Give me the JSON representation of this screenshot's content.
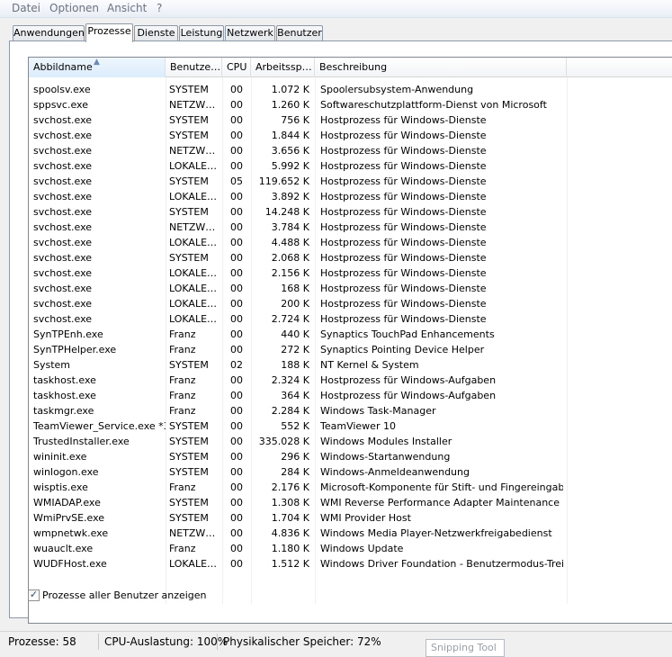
{
  "menu": [
    "Datei",
    "Optionen",
    "Ansicht",
    "?"
  ],
  "tabs": [
    "Anwendungen",
    "Prozesse",
    "Dienste",
    "Leistung",
    "Netzwerk",
    "Benutzer"
  ],
  "active_tab": "Prozesse",
  "columns": {
    "name": "Abbildname",
    "user": "Benutze…",
    "cpu": "CPU",
    "mem": "Arbeitssp…",
    "desc": "Beschreibung"
  },
  "rows": [
    {
      "name": "spoolsv.exe",
      "user": "SYSTEM",
      "cpu": "00",
      "mem": "1.072 K",
      "desc": "Spoolersubsystem-Anwendung"
    },
    {
      "name": "sppsvc.exe",
      "user": "NETZW…",
      "cpu": "00",
      "mem": "1.260 K",
      "desc": "Softwareschutzplattform-Dienst von Microsoft"
    },
    {
      "name": "svchost.exe",
      "user": "SYSTEM",
      "cpu": "00",
      "mem": "756 K",
      "desc": "Hostprozess für Windows-Dienste"
    },
    {
      "name": "svchost.exe",
      "user": "SYSTEM",
      "cpu": "00",
      "mem": "1.844 K",
      "desc": "Hostprozess für Windows-Dienste"
    },
    {
      "name": "svchost.exe",
      "user": "NETZW…",
      "cpu": "00",
      "mem": "3.656 K",
      "desc": "Hostprozess für Windows-Dienste"
    },
    {
      "name": "svchost.exe",
      "user": "LOKALE…",
      "cpu": "00",
      "mem": "5.992 K",
      "desc": "Hostprozess für Windows-Dienste"
    },
    {
      "name": "svchost.exe",
      "user": "SYSTEM",
      "cpu": "05",
      "mem": "119.652 K",
      "desc": "Hostprozess für Windows-Dienste"
    },
    {
      "name": "svchost.exe",
      "user": "LOKALE…",
      "cpu": "00",
      "mem": "3.892 K",
      "desc": "Hostprozess für Windows-Dienste"
    },
    {
      "name": "svchost.exe",
      "user": "SYSTEM",
      "cpu": "00",
      "mem": "14.248 K",
      "desc": "Hostprozess für Windows-Dienste"
    },
    {
      "name": "svchost.exe",
      "user": "NETZW…",
      "cpu": "00",
      "mem": "3.784 K",
      "desc": "Hostprozess für Windows-Dienste"
    },
    {
      "name": "svchost.exe",
      "user": "LOKALE…",
      "cpu": "00",
      "mem": "4.488 K",
      "desc": "Hostprozess für Windows-Dienste"
    },
    {
      "name": "svchost.exe",
      "user": "SYSTEM",
      "cpu": "00",
      "mem": "2.068 K",
      "desc": "Hostprozess für Windows-Dienste"
    },
    {
      "name": "svchost.exe",
      "user": "LOKALE…",
      "cpu": "00",
      "mem": "2.156 K",
      "desc": "Hostprozess für Windows-Dienste"
    },
    {
      "name": "svchost.exe",
      "user": "LOKALE…",
      "cpu": "00",
      "mem": "168 K",
      "desc": "Hostprozess für Windows-Dienste"
    },
    {
      "name": "svchost.exe",
      "user": "LOKALE…",
      "cpu": "00",
      "mem": "200 K",
      "desc": "Hostprozess für Windows-Dienste"
    },
    {
      "name": "svchost.exe",
      "user": "LOKALE…",
      "cpu": "00",
      "mem": "2.724 K",
      "desc": "Hostprozess für Windows-Dienste"
    },
    {
      "name": "SynTPEnh.exe",
      "user": "Franz",
      "cpu": "00",
      "mem": "440 K",
      "desc": "Synaptics TouchPad Enhancements"
    },
    {
      "name": "SynTPHelper.exe",
      "user": "Franz",
      "cpu": "00",
      "mem": "272 K",
      "desc": "Synaptics Pointing Device Helper"
    },
    {
      "name": "System",
      "user": "SYSTEM",
      "cpu": "02",
      "mem": "188 K",
      "desc": "NT Kernel & System"
    },
    {
      "name": "taskhost.exe",
      "user": "Franz",
      "cpu": "00",
      "mem": "2.324 K",
      "desc": "Hostprozess für Windows-Aufgaben"
    },
    {
      "name": "taskhost.exe",
      "user": "Franz",
      "cpu": "00",
      "mem": "364 K",
      "desc": "Hostprozess für Windows-Aufgaben"
    },
    {
      "name": "taskmgr.exe",
      "user": "Franz",
      "cpu": "00",
      "mem": "2.284 K",
      "desc": "Windows Task-Manager"
    },
    {
      "name": "TeamViewer_Service.exe *32",
      "user": "SYSTEM",
      "cpu": "00",
      "mem": "552 K",
      "desc": "TeamViewer 10"
    },
    {
      "name": "TrustedInstaller.exe",
      "user": "SYSTEM",
      "cpu": "00",
      "mem": "335.028 K",
      "desc": "Windows Modules Installer"
    },
    {
      "name": "wininit.exe",
      "user": "SYSTEM",
      "cpu": "00",
      "mem": "296 K",
      "desc": "Windows-Startanwendung"
    },
    {
      "name": "winlogon.exe",
      "user": "SYSTEM",
      "cpu": "00",
      "mem": "284 K",
      "desc": "Windows-Anmeldeanwendung"
    },
    {
      "name": "wisptis.exe",
      "user": "Franz",
      "cpu": "00",
      "mem": "2.176 K",
      "desc": "Microsoft-Komponente für Stift- und Fingereingabe"
    },
    {
      "name": "WMIADAP.exe",
      "user": "SYSTEM",
      "cpu": "00",
      "mem": "1.308 K",
      "desc": "WMI Reverse Performance Adapter Maintenance Utility"
    },
    {
      "name": "WmiPrvSE.exe",
      "user": "SYSTEM",
      "cpu": "00",
      "mem": "1.704 K",
      "desc": "WMI Provider Host"
    },
    {
      "name": "wmpnetwk.exe",
      "user": "NETZW…",
      "cpu": "00",
      "mem": "4.836 K",
      "desc": "Windows Media Player-Netzwerkfreigabedienst"
    },
    {
      "name": "wuauclt.exe",
      "user": "Franz",
      "cpu": "00",
      "mem": "1.180 K",
      "desc": "Windows Update"
    },
    {
      "name": "WUDFHost.exe",
      "user": "LOKALE…",
      "cpu": "00",
      "mem": "1.512 K",
      "desc": "Windows Driver Foundation - Benutzermodus-Treiber…"
    }
  ],
  "checkbox": {
    "label": "Prozesse aller Benutzer anzeigen",
    "checked": true
  },
  "status": {
    "processes": "Prozesse: 58",
    "cpu": "CPU-Auslastung: 100%",
    "memory": "Physikalischer Speicher: 72%"
  },
  "snipping_tool": "Snipping Tool"
}
